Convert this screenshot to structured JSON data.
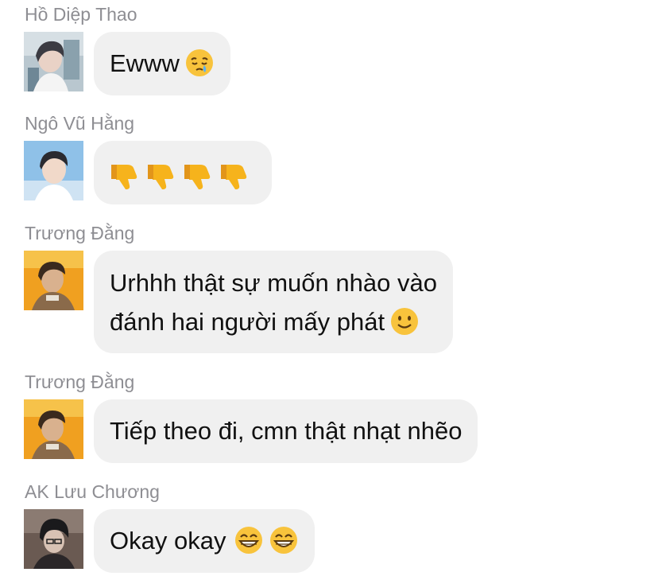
{
  "messages": [
    {
      "sender": "Hồ Diệp Thao",
      "text": "Ewww",
      "emojis": [
        "sleepy-face-icon"
      ]
    },
    {
      "sender": "Ngô Vũ Hằng",
      "text": "",
      "emojis": [
        "thumbs-down-icon",
        "thumbs-down-icon",
        "thumbs-down-icon",
        "thumbs-down-icon"
      ]
    },
    {
      "sender": "Trương Đằng",
      "line1": "Urhhh thật sự muốn nhào vào",
      "line2": "đánh hai người mấy phát",
      "emojis": [
        "slightly-smiling-face-icon"
      ]
    },
    {
      "sender": "Trương Đằng",
      "text": "Tiếp theo đi, cmn thật nhạt nhẽo",
      "emojis": []
    },
    {
      "sender": "AK Lưu Chương",
      "text": "Okay okay",
      "emojis": [
        "grinning-face-icon",
        "grinning-face-icon"
      ]
    }
  ],
  "colors": {
    "bubble": "#f0f0f0",
    "sender_name": "#8e8e93",
    "text": "#111111"
  }
}
